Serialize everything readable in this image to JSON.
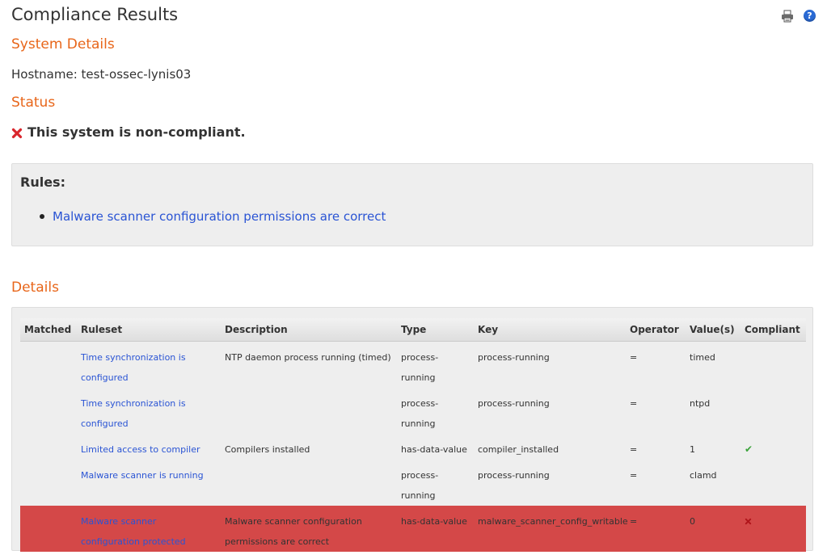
{
  "page": {
    "title": "Compliance Results",
    "print_icon": "print-icon",
    "help_icon": "help-icon",
    "help_glyph": "?"
  },
  "system_details": {
    "heading": "System Details",
    "hostname_label": "Hostname:",
    "hostname_value": "test-ossec-lynis03"
  },
  "status": {
    "heading": "Status",
    "message": "This system is non-compliant.",
    "icon": "x-icon",
    "icon_color": "#d9262c"
  },
  "rules": {
    "title": "Rules:",
    "items": [
      {
        "label": "Malware scanner configuration permissions are correct"
      }
    ]
  },
  "details": {
    "heading": "Details",
    "columns": [
      "Matched",
      "Ruleset",
      "Description",
      "Type",
      "Key",
      "Operator",
      "Value(s)",
      "Compliant"
    ],
    "rows": [
      {
        "matched": "",
        "ruleset": "Time synchronization is configured",
        "description": "NTP daemon process running (timed)",
        "type": "process-running",
        "key": "process-running",
        "operator": "=",
        "value": "timed",
        "compliant": ""
      },
      {
        "matched": "",
        "ruleset": "Time synchronization is configured",
        "description": "",
        "type": "process-running",
        "key": "process-running",
        "operator": "=",
        "value": "ntpd",
        "compliant": ""
      },
      {
        "matched": "",
        "ruleset": "Limited access to compiler",
        "description": "Compilers installed",
        "type": "has-data-value",
        "key": "compiler_installed",
        "operator": "=",
        "value": "1",
        "compliant": "check-icon"
      },
      {
        "matched": "",
        "ruleset": "Malware scanner is running",
        "description": "",
        "type": "process-running",
        "key": "process-running",
        "operator": "=",
        "value": "clamd",
        "compliant": ""
      },
      {
        "matched": "",
        "ruleset": "Malware scanner configuration protected",
        "description": "Malware scanner configuration permissions are correct",
        "type": "has-data-value",
        "key": "malware_scanner_config_writable",
        "operator": "=",
        "value": "0",
        "compliant": "x-icon"
      }
    ],
    "fail_row_color": "#d44848",
    "check_glyph": "✔"
  },
  "colors": {
    "heading_accent": "#e8661a",
    "link": "#2a54d4"
  }
}
